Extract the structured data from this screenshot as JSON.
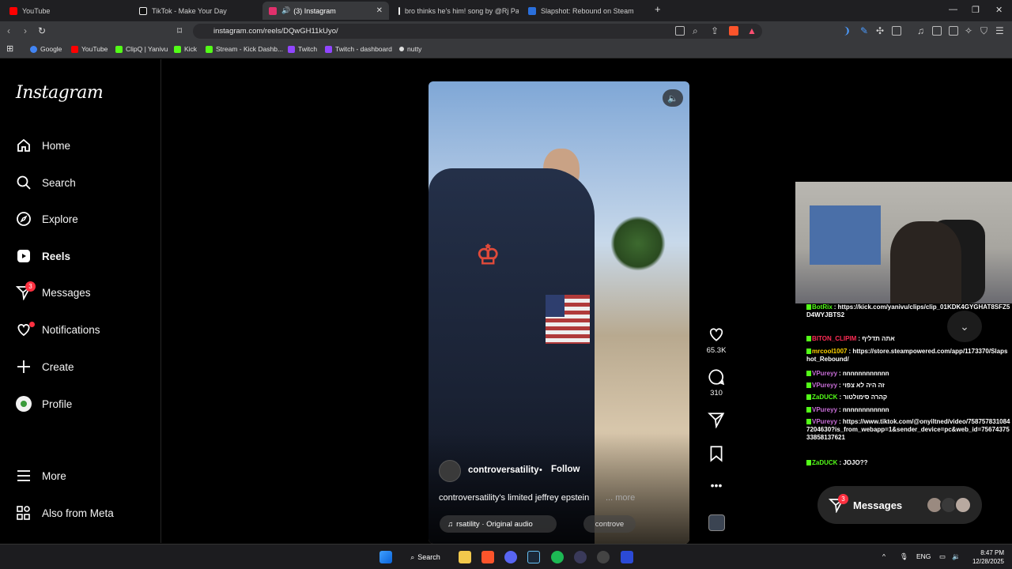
{
  "browser": {
    "tabs": [
      {
        "label": "YouTube",
        "color": "#ff0000"
      },
      {
        "label": "TikTok - Make Your Day",
        "color": "#ffffff"
      },
      {
        "label": "(3) Instagram",
        "color": "#e1306c",
        "active": true
      },
      {
        "label": "bro thinks he's him! song by @Rj Pa...",
        "color": "#ffffff"
      },
      {
        "label": "Slapshot: Rebound on Steam",
        "color": "#2a6fdb"
      }
    ],
    "url": "instagram.com/reels/DQwGH11kUyo/",
    "bookmarks": [
      "Google",
      "YouTube",
      "ClipQ | Yanivu",
      "Kick",
      "Stream - Kick Dashb...",
      "Twitch",
      "Twitch - dashboard",
      "nutty"
    ]
  },
  "sidebar": {
    "logo": "Instagram",
    "items": [
      {
        "label": "Home",
        "icon": "home-icon"
      },
      {
        "label": "Search",
        "icon": "search-icon"
      },
      {
        "label": "Explore",
        "icon": "compass-icon"
      },
      {
        "label": "Reels",
        "icon": "reels-icon",
        "active": true
      },
      {
        "label": "Messages",
        "icon": "messenger-icon",
        "badge": "3"
      },
      {
        "label": "Notifications",
        "icon": "heart-icon"
      },
      {
        "label": "Create",
        "icon": "plus-icon"
      },
      {
        "label": "Profile",
        "icon": "avatar-icon"
      }
    ],
    "bottom": [
      {
        "label": "More",
        "icon": "menu-icon"
      },
      {
        "label": "Also from Meta",
        "icon": "meta-apps-icon"
      }
    ]
  },
  "reel": {
    "author": "controversatility",
    "follow": "Follow",
    "caption": "controversatility's limited jeffrey epstein",
    "more": "... more",
    "audio": "rsatility · Original audio",
    "audio_right": "controve",
    "likes": "65.3K",
    "comments": "310"
  },
  "chat": [
    {
      "user": "BotRix",
      "color": "#53fc18",
      "text": "https://kick.com/yanivu/clips/clip_01KDK4GYGHAT8SFZ5D4WYJBTS2"
    },
    {
      "user": "BITON_CLIPIM",
      "color": "#ff2d55",
      "text": "אתה תדליף"
    },
    {
      "user": "mrcool1007",
      "color": "#ffd400",
      "text": "https://store.steampowered.com/app/1173370/Slapshot_Rebound/"
    },
    {
      "user": "VPureyy",
      "color": "#c86dd7",
      "text": "nnnnnnnnnnnn"
    },
    {
      "user": "VPureyy",
      "color": "#c86dd7",
      "text": "זה היה לא צפוי"
    },
    {
      "user": "ZaDUCK",
      "color": "#53fc18",
      "text": "קהרה סימולטור"
    },
    {
      "user": "VPureyy",
      "color": "#c86dd7",
      "text": "nnnnnnnnnnnn"
    },
    {
      "user": "VPureyy",
      "color": "#c86dd7",
      "text": "https://www.tiktok.com/@onyiltned/video/7587578310847204630?is_from_webapp=1&sender_device=pc&web_id=7567437533858137621"
    },
    {
      "user": "ZaDUCK",
      "color": "#53fc18",
      "text": "JOJO??"
    }
  ],
  "messages_pill": {
    "label": "Messages",
    "badge": "3"
  },
  "taskbar": {
    "search": "Search",
    "lang": "ENG",
    "time": "8:47 PM",
    "date": "12/28/2025"
  }
}
